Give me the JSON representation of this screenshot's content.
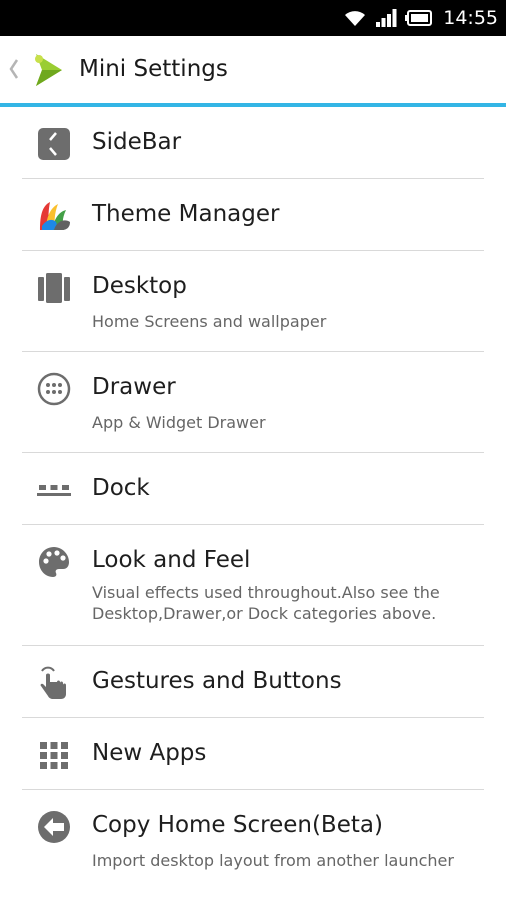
{
  "status_bar": {
    "time": "14:55",
    "icons": [
      "wifi-icon",
      "signal-icon",
      "battery-icon"
    ]
  },
  "action_bar": {
    "title": "Mini Settings",
    "back_icon": "chevron-left-icon",
    "logo_icon": "app-logo-icon",
    "accent_color": "#33b5e5"
  },
  "items": [
    {
      "title": "SideBar",
      "subtitle": "",
      "icon": "sidebar-icon"
    },
    {
      "title": "Theme Manager",
      "subtitle": "",
      "icon": "theme-manager-icon"
    },
    {
      "title": "Desktop",
      "subtitle": "Home Screens and wallpaper",
      "icon": "desktop-icon"
    },
    {
      "title": "Drawer",
      "subtitle": "App & Widget Drawer",
      "icon": "drawer-icon"
    },
    {
      "title": "Dock",
      "subtitle": "",
      "icon": "dock-icon"
    },
    {
      "title": "Look and Feel",
      "subtitle": "Visual effects used throughout.Also see the Desktop,Drawer,or Dock categories above.",
      "icon": "palette-icon"
    },
    {
      "title": "Gestures and Buttons",
      "subtitle": "",
      "icon": "gesture-icon"
    },
    {
      "title": "New Apps",
      "subtitle": "",
      "icon": "new-apps-grid-icon"
    },
    {
      "title": "Copy Home Screen(Beta)",
      "subtitle": "Import desktop layout from another launcher",
      "icon": "copy-home-screen-icon"
    }
  ]
}
